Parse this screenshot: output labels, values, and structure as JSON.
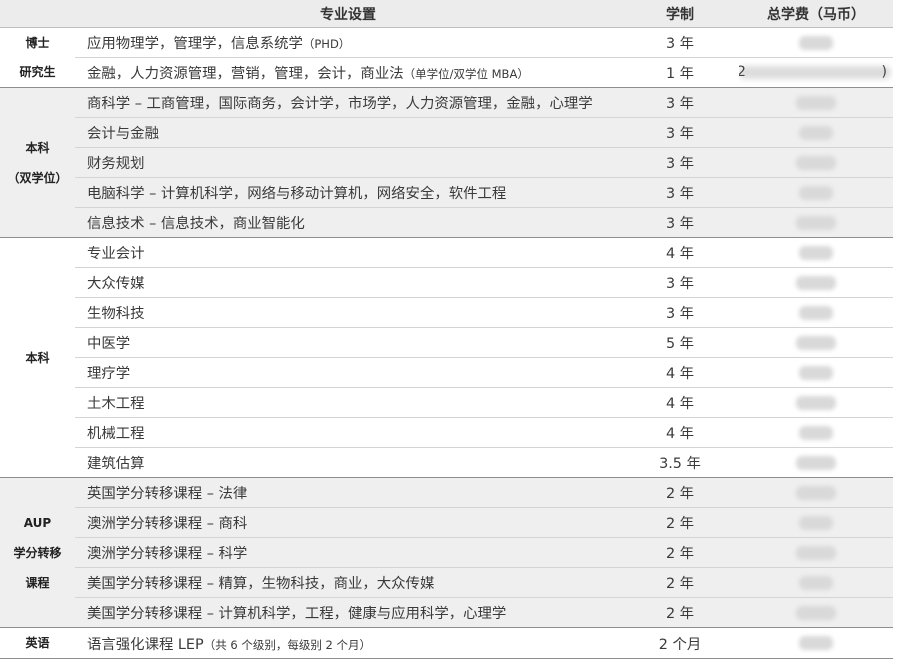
{
  "header": {
    "major": "专业设置",
    "years": "学制",
    "fee": "总学费（马币）"
  },
  "groups": [
    {
      "cat_lines": [
        "博士",
        "研究生"
      ],
      "rows": [
        {
          "major": "应用物理学，管理学，信息系统学",
          "note": "（PHD）",
          "years": "3 年"
        },
        {
          "major": "金融，人力资源管理，营销，管理，会计，商业法",
          "note": "（单学位/双学位 MBA）",
          "years": "1 年",
          "fee_left": "2",
          "fee_right": ")"
        }
      ]
    },
    {
      "cat_lines": [
        "本科",
        "（双学位）"
      ],
      "rows": [
        {
          "major": "商科学 – 工商管理，国际商务，会计学，市场学，人力资源管理，金融，心理学",
          "years": "3 年"
        },
        {
          "major": "会计与金融",
          "years": "3 年"
        },
        {
          "major": "财务规划",
          "years": "3 年"
        },
        {
          "major": "电脑科学 – 计算机科学，网络与移动计算机，网络安全，软件工程",
          "years": "3 年"
        },
        {
          "major": "信息技术 – 信息技术，商业智能化",
          "years": "3 年"
        }
      ]
    },
    {
      "cat_lines": [
        "本科"
      ],
      "rows": [
        {
          "major": "专业会计",
          "years": "4 年"
        },
        {
          "major": "大众传媒",
          "years": "3 年"
        },
        {
          "major": "生物科技",
          "years": "3 年"
        },
        {
          "major": "中医学",
          "years": "5 年"
        },
        {
          "major": "理疗学",
          "years": "4 年"
        },
        {
          "major": "土木工程",
          "years": "4 年"
        },
        {
          "major": "机械工程",
          "years": "4 年"
        },
        {
          "major": "建筑估算",
          "years": "3.5 年"
        }
      ]
    },
    {
      "cat_lines": [
        "AUP",
        "学分转移",
        "课程"
      ],
      "rows": [
        {
          "major": "英国学分转移课程 – 法律",
          "years": "2 年"
        },
        {
          "major": "澳洲学分转移课程 – 商科",
          "years": "2 年"
        },
        {
          "major": "澳洲学分转移课程 – 科学",
          "years": "2 年"
        },
        {
          "major": "美国学分转移课程 – 精算，生物科技，商业，大众传媒",
          "years": "2 年"
        },
        {
          "major": "美国学分转移课程 – 计算机科学，工程，健康与应用科学，心理学",
          "years": "2 年"
        }
      ]
    },
    {
      "cat_lines": [
        "英语"
      ],
      "rows": [
        {
          "major": "语言强化课程 LEP",
          "note": "（共 6 个级别，每级别 2 个月）",
          "years": "2 个月"
        }
      ]
    }
  ]
}
